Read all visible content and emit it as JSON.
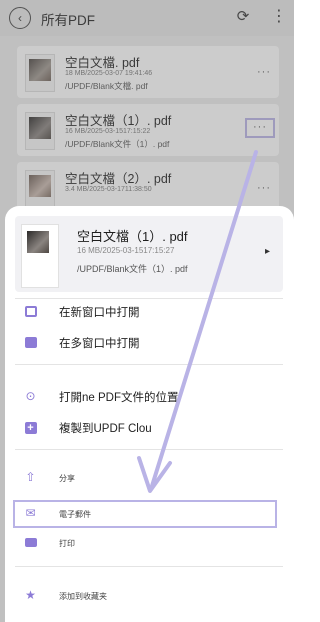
{
  "header": {
    "back_glyph": "‹",
    "title": "所有PDF",
    "refresh_glyph": "⟳",
    "more_glyph": "⋮"
  },
  "files": [
    {
      "name": "空白文檔. pdf",
      "meta": "18 MB/2025-03-07 19:41:46",
      "path": "/UPDF/Blank文檔. pdf"
    },
    {
      "name": "空白文檔（1）. pdf",
      "meta": "16 MB/2025-03-1517:15:22",
      "path": "/UPDF/Blank文件（1）. pdf"
    },
    {
      "name": "空白文檔（2）. pdf",
      "meta": "3.4 MB/2025-03-1711:38:50",
      "path": ""
    }
  ],
  "row_more_glyph": "···",
  "sheet": {
    "file": {
      "name": "空白文檔（1）. pdf",
      "meta": "16 MB/2025-03-1517:15:27",
      "path": "/UPDF/Blank文件（1）. pdf",
      "chevron": "▸"
    },
    "menu": [
      {
        "label": "在新窗口中打開",
        "icon": "new-window-icon"
      },
      {
        "label": "在多窗口中打開",
        "icon": "multi-window-icon"
      },
      {
        "label": "打開ne PDF文件的位置",
        "icon": "file-location-icon"
      },
      {
        "label": "複製到UPDF Clou",
        "icon": "copy-to-cloud-icon"
      },
      {
        "label": "分享",
        "icon": "share-icon"
      },
      {
        "label": "電子郵件",
        "icon": "mail-icon"
      },
      {
        "label": "打印",
        "icon": "print-icon"
      },
      {
        "label": "添加到收藏夹",
        "icon": "favorite-icon"
      }
    ]
  },
  "colors": {
    "accent": "#8c7bd6",
    "highlight": "#b9b3e6"
  }
}
